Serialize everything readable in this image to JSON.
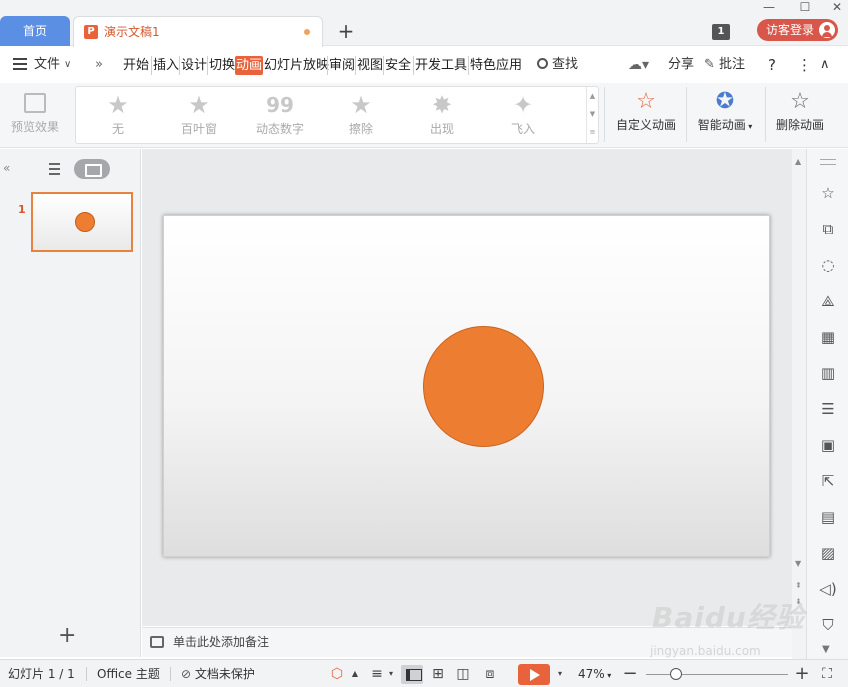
{
  "titlebar": {
    "home_tab": "首页",
    "doc_tab": "演示文稿1",
    "add_tab_glyph": "+",
    "window_badge": "1",
    "visitor_login": "访客登录"
  },
  "menu": {
    "file": "文件",
    "more_glyph": "»",
    "tabs": [
      "开始",
      "插入",
      "设计",
      "切换",
      "动画",
      "幻灯片放映",
      "审阅",
      "视图",
      "安全",
      "开发工具",
      "特色应用"
    ],
    "active_tab": "动画",
    "search": "查找",
    "share": "分享",
    "comment": "批注",
    "help_glyph": "?",
    "more_options_glyph": "⋮",
    "collapse_glyph": "∧"
  },
  "ribbon": {
    "preview": "预览效果",
    "gallery": [
      {
        "label": "无",
        "icon": "star-icon"
      },
      {
        "label": "百叶窗",
        "icon": "blinds-star-icon"
      },
      {
        "label": "动态数字",
        "icon": "digits-icon"
      },
      {
        "label": "擦除",
        "icon": "wipe-star-icon"
      },
      {
        "label": "出现",
        "icon": "appear-star-icon"
      },
      {
        "label": "飞入",
        "icon": "fly-in-star-icon"
      }
    ],
    "custom_animation": "自定义动画",
    "smart_animation": "智能动画",
    "delete_animation": "删除动画"
  },
  "slides_panel": {
    "slide_number": "1",
    "add_glyph": "+"
  },
  "notes": {
    "placeholder": "单击此处添加备注"
  },
  "status": {
    "slide_count": "幻灯片 1 / 1",
    "theme": "Office 主题",
    "protection": "文档未保护",
    "zoom": "47%",
    "zoom_minus": "−",
    "zoom_plus": "+"
  },
  "watermark": {
    "brand": "Baidu经验",
    "url": "jingyan.baidu.com"
  },
  "colors": {
    "accent": "#e8633b",
    "shape_fill": "#ed7d31",
    "home_tab": "#5b8fe3",
    "visitor_btn": "#d9574a"
  }
}
